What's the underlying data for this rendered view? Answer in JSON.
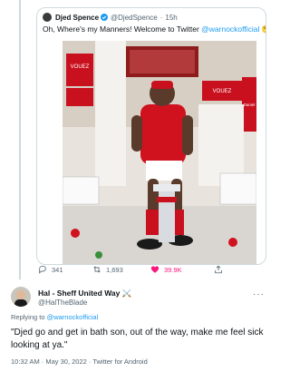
{
  "quoted_tweet": {
    "author_name": "Djed Spence",
    "handle": "@DjedSpence",
    "separator": "·",
    "time": "15h",
    "text_prefix": "Oh, Where's my Manners! Welcome to Twitter ",
    "mention": "@warnockofficial",
    "emoji": "😘",
    "media": {
      "sign_top_left": "VOUEZ",
      "sign_top_right": "VOUEZ",
      "sign_right": "Daniel"
    }
  },
  "action_bar": {
    "reply_count": "341",
    "retweet_count": "1,693",
    "like_count": "39.9K",
    "accent_like": "#f91880",
    "accent_link": "#1d9bf0"
  },
  "reply": {
    "author_name": "Hal - Sheff United Way ⚔️",
    "handle": "@HalTheBlade",
    "replying_prefix": "Replying to ",
    "replying_to": "@warnockofficial",
    "text": "\"Djed go and get in bath son, out of the way, make me feel sick looking at ya.\"",
    "timestamp": "10:32 AM · May 30, 2022 · Twitter for Android"
  }
}
